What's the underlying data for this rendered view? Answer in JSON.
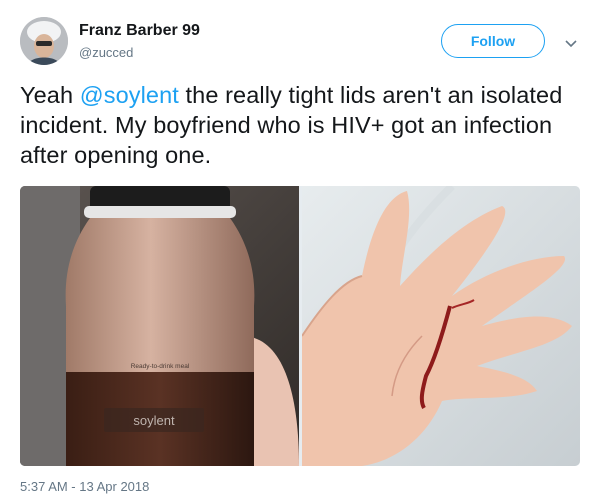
{
  "author": {
    "display_name": "Franz Barber 99",
    "handle": "@zucced"
  },
  "follow_button": {
    "label": "Follow"
  },
  "tweet": {
    "text_prefix": "Yeah ",
    "mention": "@soylent",
    "text_suffix": " the really tight lids aren't an isolated incident.  My boyfriend who is HIV+ got an infection after opening one."
  },
  "media": {
    "left_photo": {
      "bottle_label": "Ready-to-drink meal",
      "brand": "soylent"
    }
  },
  "timestamp": "5:37 AM - 13 Apr 2018",
  "colors": {
    "accent": "#1da1f2",
    "text": "#14171a",
    "secondary": "#657786"
  },
  "icons": {
    "avatar": "avatar-image",
    "more": "chevron-down-icon"
  }
}
